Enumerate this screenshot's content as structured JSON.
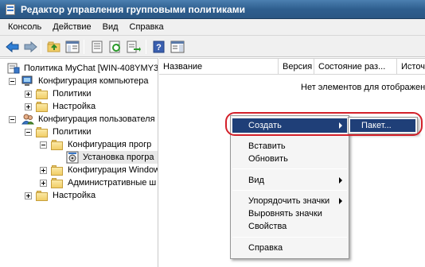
{
  "window": {
    "title": "Редактор управления групповыми политиками"
  },
  "menubar": {
    "items": [
      "Консоль",
      "Действие",
      "Вид",
      "Справка"
    ]
  },
  "toolbar": {
    "buttons": [
      "back-arrow-icon",
      "forward-arrow-icon",
      "up-folder-icon",
      "show-tree-icon",
      "properties-icon",
      "refresh-icon",
      "export-list-icon",
      "help-icon",
      "show-hide-action-pane-icon"
    ]
  },
  "tree": {
    "root": "Политика MyChat [WIN-408YMY3I",
    "computer_config": "Конфигурация компьютера",
    "computer_policies": "Политики",
    "computer_settings": "Настройка",
    "user_config": "Конфигурация пользователя",
    "user_policies": "Политики",
    "software_config": "Конфигурация прогр",
    "software_install": "Установка програ",
    "windows_config": "Конфигурация Window",
    "admin_templates": "Административные ш",
    "user_settings": "Настройка"
  },
  "list": {
    "columns": [
      "Название",
      "Версия",
      "Состояние раз...",
      "Источ"
    ],
    "empty_message": "Нет элементов для отображен"
  },
  "context_menu": {
    "create": "Создать",
    "paste": "Вставить",
    "refresh": "Обновить",
    "view": "Вид",
    "arrange_icons": "Упорядочить значки",
    "line_up_icons": "Выровнять значки",
    "properties": "Свойства",
    "help": "Справка"
  },
  "submenu": {
    "package": "Пакет..."
  },
  "colors": {
    "title_bar": "#2f5f8f",
    "menu_highlight": "#1f3f78",
    "annotation_outline": "#d3202a"
  }
}
